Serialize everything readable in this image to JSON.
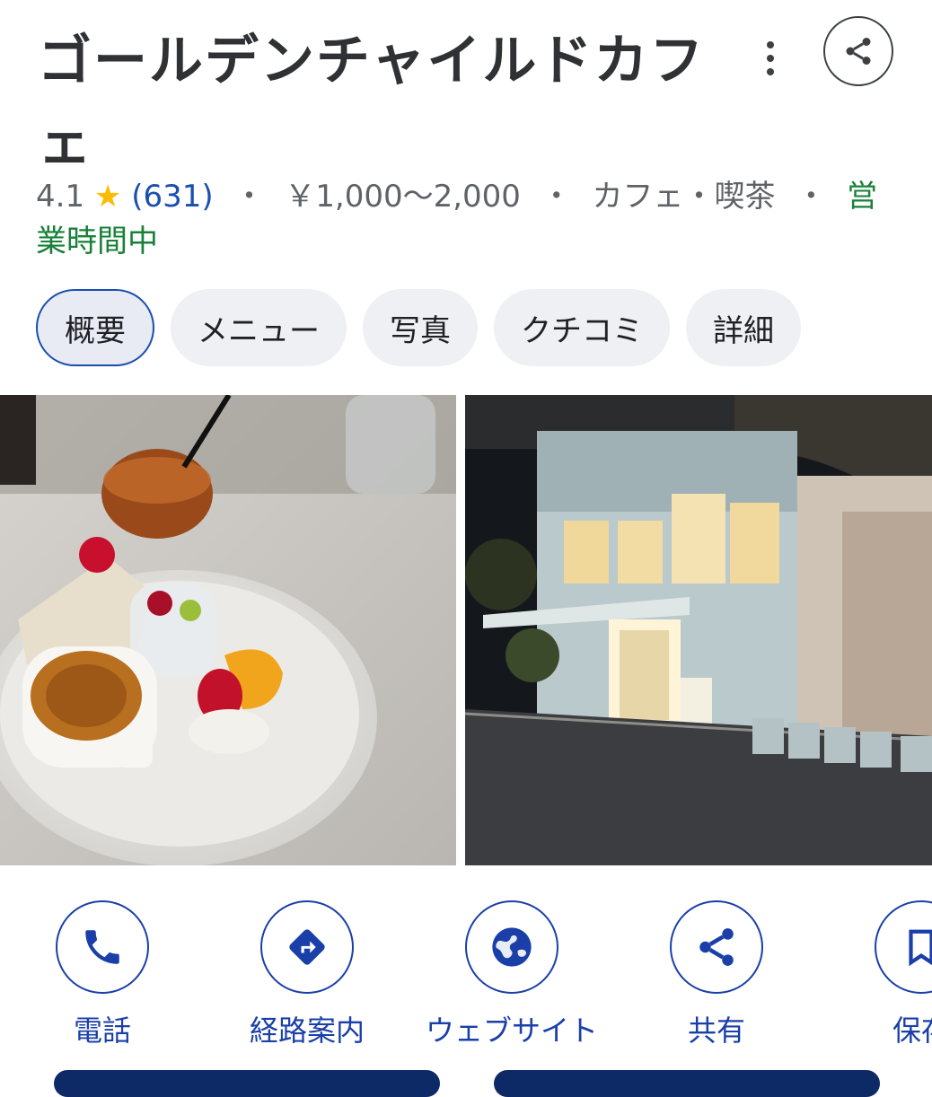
{
  "place": {
    "title": "ゴールデンチャイルドカフェ",
    "rating": "4.1",
    "star": "★",
    "reviews": "(631)",
    "sep": "・",
    "price": "￥1,000〜2,000",
    "category": "カフェ・喫茶",
    "status": "営業時間中"
  },
  "tabs": [
    "概要",
    "メニュー",
    "写真",
    "クチコミ",
    "詳細"
  ],
  "actions": [
    {
      "label": "電話",
      "icon": "phone-icon"
    },
    {
      "label": "経路案内",
      "icon": "directions-icon"
    },
    {
      "label": "ウェブサイト",
      "icon": "globe-icon"
    },
    {
      "label": "共有",
      "icon": "share-icon"
    },
    {
      "label": "保存",
      "icon": "bookmark-icon"
    }
  ],
  "colors": {
    "accent": "#1a3fa8",
    "open": "#188038",
    "star": "#fbbc04"
  }
}
